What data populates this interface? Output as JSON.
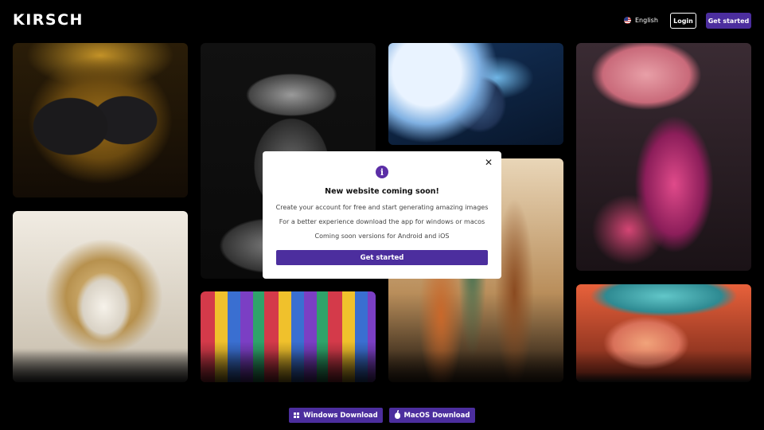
{
  "header": {
    "logo": "KIRSCH",
    "language": "English",
    "login_label": "Login",
    "get_started_label": "Get started"
  },
  "gallery": {
    "images": [
      {
        "name": "bee"
      },
      {
        "name": "elder-portrait"
      },
      {
        "name": "armored-knight"
      },
      {
        "name": "parasol-dancer"
      },
      {
        "name": "white-wolf"
      },
      {
        "name": "colorful-houses"
      },
      {
        "name": "city-towers"
      },
      {
        "name": "robot-girl"
      }
    ]
  },
  "modal": {
    "title": "New website coming soon!",
    "line1": "Create your account for free and start generating amazing images",
    "line2": "For a better experience download the app for windows or macos",
    "line3": "Coming soon versions for Android and iOS",
    "button_label": "Get started",
    "close_symbol": "✕",
    "info_symbol": "i"
  },
  "downloads": {
    "windows_label": "Windows Download",
    "mac_label": "MacOS Download"
  },
  "colors": {
    "accent": "#4c2e9e",
    "background": "#000000"
  }
}
